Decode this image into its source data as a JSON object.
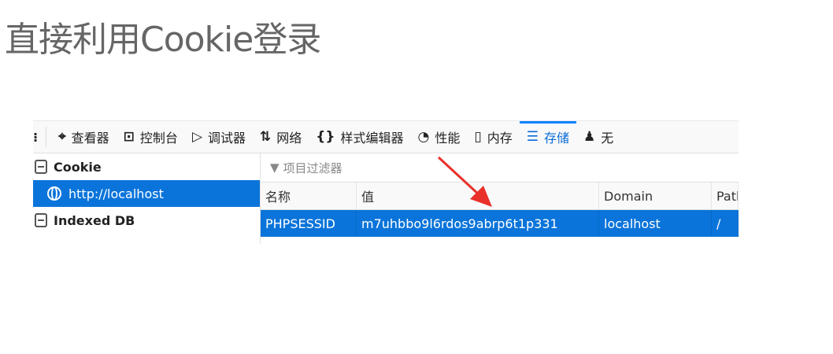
{
  "title": "直接利用Cookie登录",
  "toolbar": {
    "tabs": [
      {
        "icon": "inspector-icon",
        "glyph": "⌖",
        "label": "查看器"
      },
      {
        "icon": "console-icon",
        "glyph": "⊡",
        "label": "控制台"
      },
      {
        "icon": "debugger-icon",
        "glyph": "▷",
        "label": "调试器"
      },
      {
        "icon": "network-icon",
        "glyph": "⇅",
        "label": "网络"
      },
      {
        "icon": "style-editor-icon",
        "glyph": "{}",
        "label": "样式编辑器"
      },
      {
        "icon": "performance-icon",
        "glyph": "◔",
        "label": "性能"
      },
      {
        "icon": "memory-icon",
        "glyph": "▯",
        "label": "内存"
      },
      {
        "icon": "storage-icon",
        "glyph": "☰",
        "label": "存储"
      },
      {
        "icon": "accessibility-icon",
        "glyph": "♟",
        "label": "无"
      }
    ],
    "active": "存储"
  },
  "sidebar": {
    "items": [
      {
        "label": "Cookie"
      },
      {
        "label": "http://localhost",
        "selected": true
      },
      {
        "label": "Indexed DB"
      }
    ]
  },
  "filter": {
    "placeholder": "项目过滤器"
  },
  "table": {
    "columns": [
      "名称",
      "值",
      "Domain",
      "Path"
    ],
    "rows": [
      [
        "PHPSESSID",
        "m7uhbbo9l6rdos9abrp6t1p331",
        "localhost",
        "/"
      ]
    ]
  },
  "colors": {
    "accent": "#0a74da",
    "arrow": "#e8312a"
  }
}
